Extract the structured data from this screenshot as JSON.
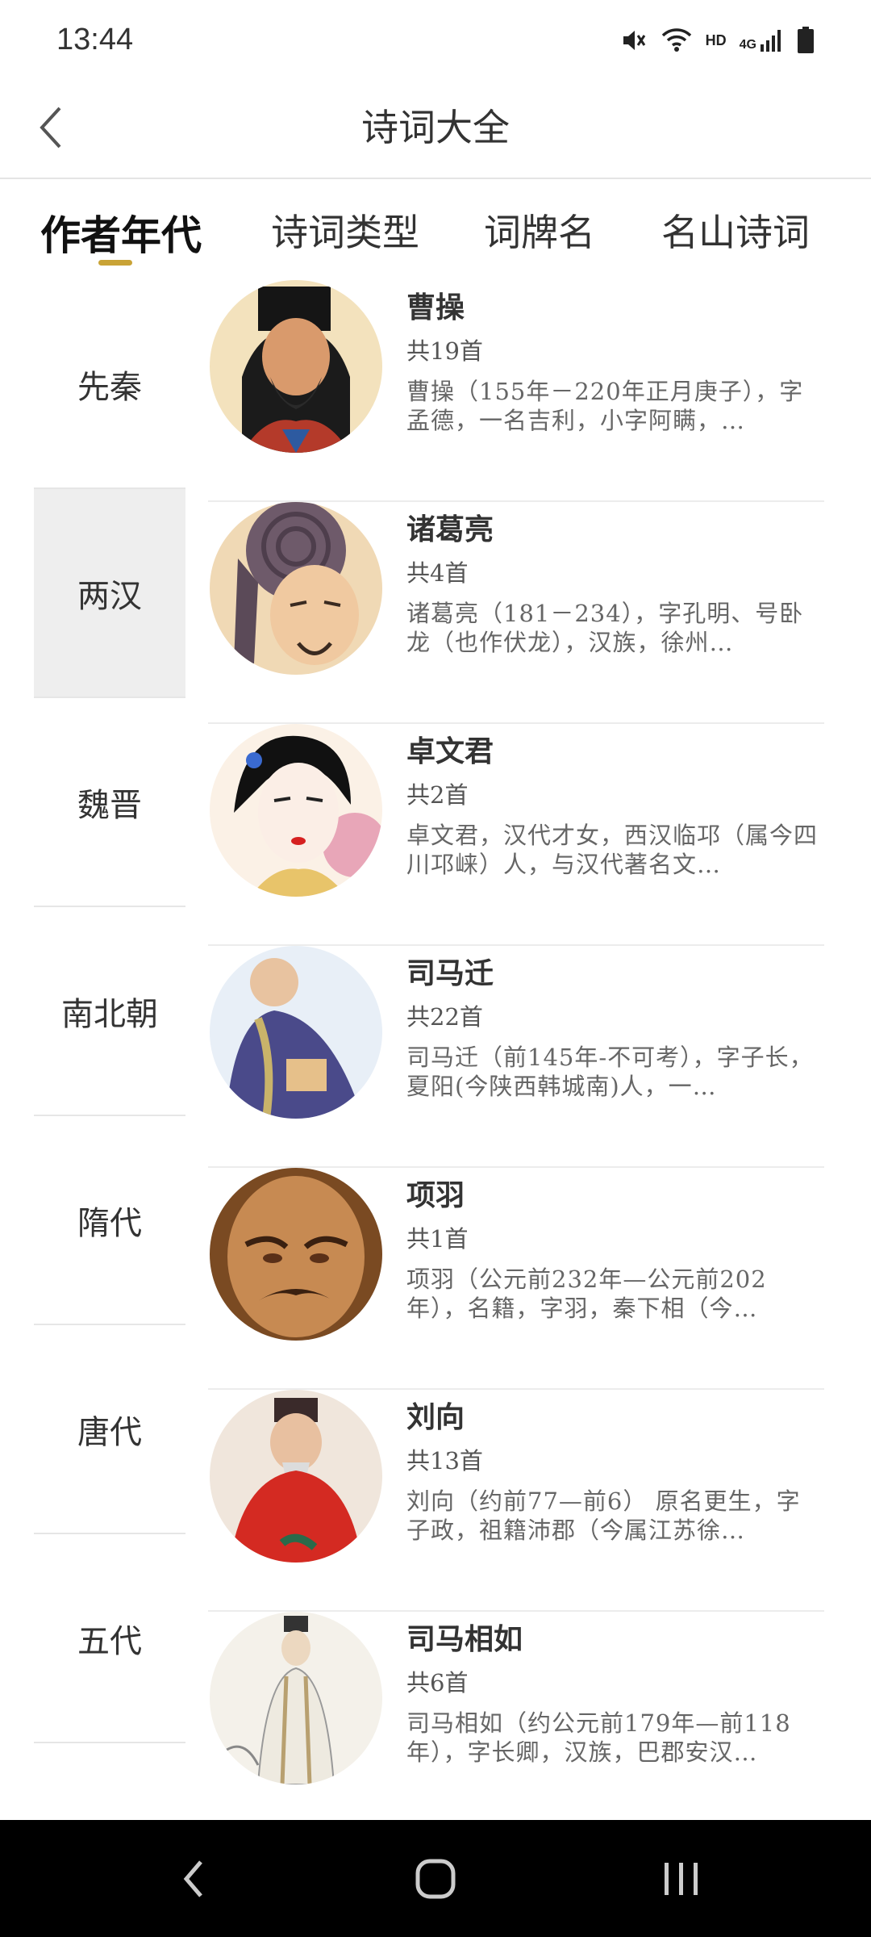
{
  "status_bar": {
    "time": "13:44",
    "hd": "HD",
    "network": "4G",
    "icons": [
      "mute-icon",
      "wifi-icon",
      "signal-icon",
      "battery-icon"
    ]
  },
  "header": {
    "title": "诗词大全",
    "back_icon": "chevron-left-icon"
  },
  "tabs": [
    {
      "label": "作者年代",
      "active": true
    },
    {
      "label": "诗词类型",
      "active": false
    },
    {
      "label": "词牌名",
      "active": false
    },
    {
      "label": "名山诗词",
      "active": false
    }
  ],
  "colors": {
    "accent": "#c9a336",
    "selected_bg": "#eeeeee",
    "divider": "#e6e6e6"
  },
  "eras": [
    {
      "label": "先秦",
      "selected": false
    },
    {
      "label": "两汉",
      "selected": true
    },
    {
      "label": "魏晋",
      "selected": false
    },
    {
      "label": "南北朝",
      "selected": false
    },
    {
      "label": "隋代",
      "selected": false
    },
    {
      "label": "唐代",
      "selected": false
    },
    {
      "label": "五代",
      "selected": false
    }
  ],
  "authors": [
    {
      "name": "曹操",
      "count": "共19首",
      "desc": "曹操（155年－220年正月庚子），字孟德，一名吉利，小字阿瞒，…"
    },
    {
      "name": "诸葛亮",
      "count": "共4首",
      "desc": "诸葛亮（181－234），字孔明、号卧龙（也作伏龙），汉族，徐州…"
    },
    {
      "name": "卓文君",
      "count": "共2首",
      "desc": "卓文君，汉代才女，西汉临邛（属今四川邛崃）人，与汉代著名文…"
    },
    {
      "name": "司马迁",
      "count": "共22首",
      "desc": "司马迁（前145年-不可考），字子长，夏阳(今陕西韩城南)人，一…"
    },
    {
      "name": "项羽",
      "count": "共1首",
      "desc": "项羽（公元前232年—公元前202年），名籍，字羽，秦下相（今…"
    },
    {
      "name": "刘向",
      "count": "共13首",
      "desc": "刘向（约前77—前6） 原名更生，字子政，祖籍沛郡（今属江苏徐…"
    },
    {
      "name": "司马相如",
      "count": "共6首",
      "desc": "司马相如（约公元前179年—前118年），字长卿，汉族，巴郡安汉…"
    }
  ],
  "nav_bar": {
    "icons": [
      "nav-back-icon",
      "nav-home-icon",
      "nav-recents-icon"
    ]
  }
}
